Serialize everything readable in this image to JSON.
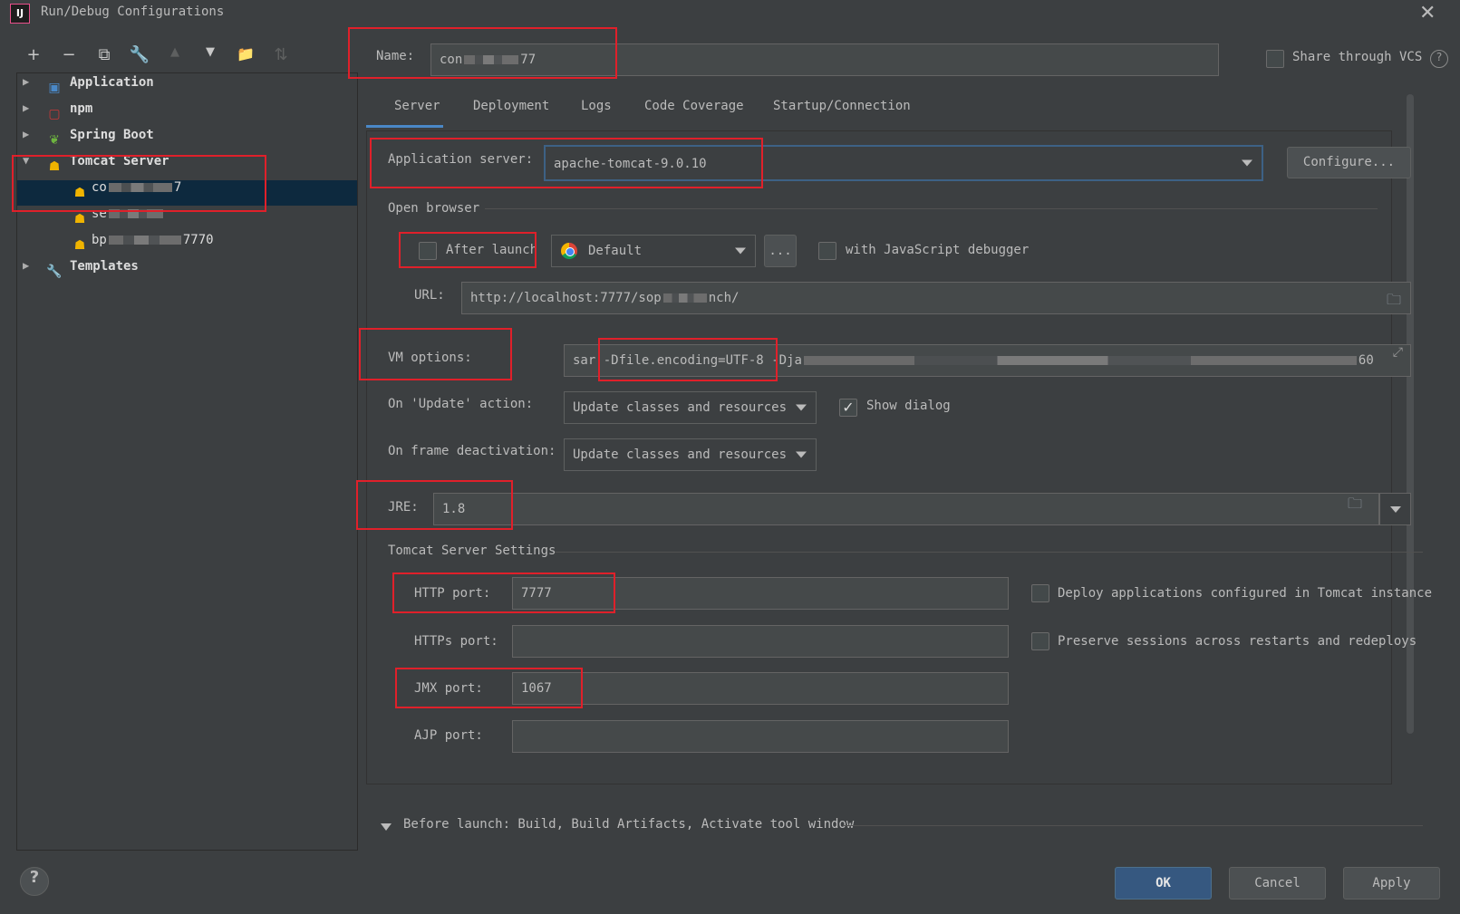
{
  "window": {
    "title": "Run/Debug Configurations",
    "app_icon_text": "IJ",
    "close_glyph": "✕"
  },
  "toolbar": {
    "add": "+",
    "remove": "−",
    "copy": "⧉",
    "edit_defaults": "🔧",
    "move_up": "▲",
    "move_down": "▼",
    "new_folder": "📁",
    "sort": "⇅"
  },
  "tree": {
    "items": [
      {
        "label": "Application",
        "icon": "application-icon",
        "expanded": false
      },
      {
        "label": "npm",
        "icon": "npm-icon",
        "expanded": false
      },
      {
        "label": "Spring Boot",
        "icon": "spring-boot-icon",
        "expanded": false
      },
      {
        "label": "Tomcat Server",
        "icon": "tomcat-icon",
        "expanded": true,
        "children": [
          {
            "prefix": "co",
            "suffix": "7",
            "selected": true
          },
          {
            "prefix": "se",
            "suffix": "",
            "selected": false
          },
          {
            "prefix": "bp",
            "suffix": "7770",
            "selected": false
          }
        ]
      },
      {
        "label": "Templates",
        "icon": "wrench-icon",
        "expanded": false
      }
    ]
  },
  "name_field": {
    "label": "Name:",
    "value_prefix": "con",
    "value_suffix": "77"
  },
  "share_vcs": {
    "label": "Share through VCS",
    "checked": false,
    "help": "?"
  },
  "tabs": [
    "Server",
    "Deployment",
    "Logs",
    "Code Coverage",
    "Startup/Connection"
  ],
  "active_tab": "Server",
  "server": {
    "app_server_label": "Application server:",
    "app_server_value": "apache-tomcat-9.0.10",
    "configure_button": "Configure...",
    "open_browser_label": "Open browser",
    "after_launch_label": "After launch",
    "after_launch_checked": false,
    "browser_value": "Default",
    "browser_more": "...",
    "js_debugger_label": "with JavaScript debugger",
    "js_debugger_checked": false,
    "url_label": "URL:",
    "url_prefix": "http://localhost:7777/sop",
    "url_suffix": "nch/",
    "vm_options_label": "VM options:",
    "vm_options_start": "sar",
    "vm_options_encoding": "-Dfile.encoding=UTF-8",
    "vm_options_dja": "-Dja",
    "vm_options_end": "60",
    "on_update_label": "On 'Update' action:",
    "on_update_value": "Update classes and resources",
    "show_dialog_label": "Show dialog",
    "show_dialog_checked": true,
    "on_frame_label": "On frame deactivation:",
    "on_frame_value": "Update classes and resources",
    "jre_label": "JRE:",
    "jre_value": "1.8",
    "tomcat_settings_label": "Tomcat Server Settings",
    "http_port_label": "HTTP port:",
    "http_port_value": "7777",
    "https_port_label": "HTTPs port:",
    "https_port_value": "",
    "jmx_port_label": "JMX port:",
    "jmx_port_value": "1067",
    "ajp_port_label": "AJP port:",
    "ajp_port_value": "",
    "deploy_apps_label": "Deploy applications configured in Tomcat instance",
    "deploy_apps_checked": false,
    "preserve_sessions_label": "Preserve sessions across restarts and redeploys",
    "preserve_sessions_checked": false
  },
  "before_launch": {
    "label": "Before launch: Build, Build Artifacts, Activate tool window"
  },
  "footer": {
    "help": "?",
    "ok": "OK",
    "cancel": "Cancel",
    "apply": "Apply"
  },
  "colors": {
    "background": "#3c3f41",
    "selection": "#0d293e",
    "highlight": "#e0202a",
    "accent": "#4a88c7",
    "primary_button": "#365880"
  }
}
